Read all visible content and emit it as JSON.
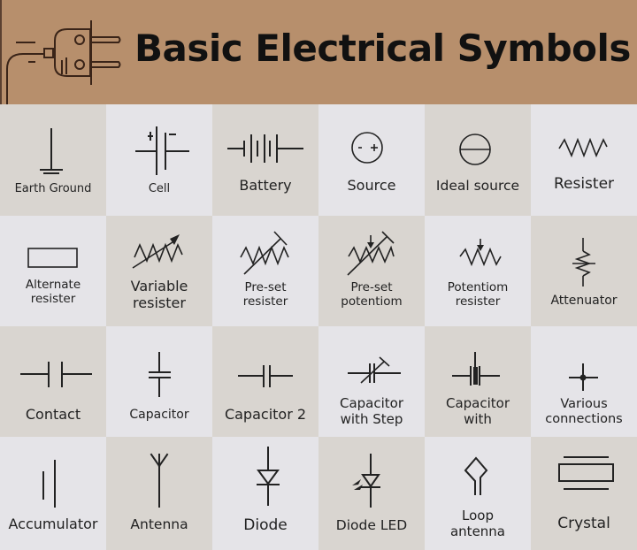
{
  "header": {
    "title": "Basic Electrical Symbols",
    "icon": "plug-icon",
    "background_color": "#b78f6c"
  },
  "colors": {
    "cell_dark": "#d9d5d0",
    "cell_light": "#e5e4e8",
    "symbol_stroke": "#222222"
  },
  "symbols": [
    {
      "label": "Earth Ground",
      "icon": "earth-ground-icon"
    },
    {
      "label": "Cell",
      "icon": "cell-icon"
    },
    {
      "label": "Battery",
      "icon": "battery-icon"
    },
    {
      "label": "Source",
      "icon": "source-icon"
    },
    {
      "label": "Ideal source",
      "icon": "ideal-source-icon"
    },
    {
      "label": "Resister",
      "icon": "resistor-icon"
    },
    {
      "label": "Alternate resister",
      "line1": "Alternate",
      "line2": "resister",
      "icon": "alternate-resistor-icon"
    },
    {
      "label": "Variable resister",
      "line1": "Variable",
      "line2": "resister",
      "icon": "variable-resistor-icon"
    },
    {
      "label": "Pre-set resister",
      "line1": "Pre-set",
      "line2": "resister",
      "icon": "preset-resistor-icon"
    },
    {
      "label": "Pre-set potentiom",
      "line1": "Pre-set",
      "line2": "potentiom",
      "icon": "preset-potentiometer-icon"
    },
    {
      "label": "Potentiom resister",
      "line1": "Potentiom",
      "line2": "resister",
      "icon": "potentiometer-icon"
    },
    {
      "label": "Attenuator",
      "icon": "attenuator-icon"
    },
    {
      "label": "Contact",
      "icon": "contact-icon"
    },
    {
      "label": "Capacitor",
      "icon": "capacitor-icon"
    },
    {
      "label": "Capacitor 2",
      "icon": "capacitor-2-icon"
    },
    {
      "label": "Capacitor with Step",
      "line1": "Capacitor",
      "line2": "with Step",
      "icon": "capacitor-step-icon"
    },
    {
      "label": "Capacitor with",
      "line1": "Capacitor",
      "line2": "with",
      "icon": "capacitor-with-icon"
    },
    {
      "label": "Various connections",
      "line1": "Various",
      "line2": "connections",
      "icon": "junction-icon"
    },
    {
      "label": "Accumulator",
      "icon": "accumulator-icon"
    },
    {
      "label": "Antenna",
      "icon": "antenna-icon"
    },
    {
      "label": "Diode",
      "icon": "diode-icon"
    },
    {
      "label": "Diode LED",
      "icon": "led-icon"
    },
    {
      "label": "Loop antenna",
      "line1": "Loop",
      "line2": "antenna",
      "icon": "loop-antenna-icon"
    },
    {
      "label": "Crystal",
      "icon": "crystal-icon"
    }
  ]
}
